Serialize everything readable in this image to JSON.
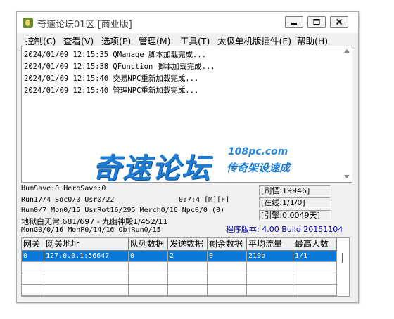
{
  "window": {
    "title": "奇速论坛01区 [商业版]"
  },
  "menu": [
    "控制(C)",
    "查看(V)",
    "选项(P)",
    "管理(M)",
    "工具(T)",
    "太极单机版插件(E)",
    "帮助(H)"
  ],
  "log": [
    "2024/01/09 12:15:35 QManage 脚本加载完成...",
    "2024/01/09 12:15:38 QFunction 脚本加载完成...",
    "2024/01/09 12:15:40 交易NPC重新加载完成...",
    "2024/01/09 12:15:40 管理NPC重新加载完成..."
  ],
  "watermark": {
    "main": "奇速论坛",
    "url": "108pc.com",
    "slogan": "传奇架设速成"
  },
  "status": {
    "line1": "HumSave:0 HeroSave:0",
    "line2a": "Run17/4 Soc0/0 Usr0/22",
    "line2b": "0:7:4 [M][F]",
    "line3": "Hum0/7 Mon0/15 UsrRot16/295 Merch0/16 Npc0/0 (0)",
    "line4": "地狱白无常,681/697 - 九幽神殿1/452/11",
    "line5": "MonG0/0/16 MonP0/14/16 ObjRun0/15"
  },
  "boxes": {
    "refresh": "[刷怪:19946]",
    "online": "[在线:1/1/0]",
    "engine": "[引擎:0.0049天]"
  },
  "version": "程序版本: 4.00 Build 20151104",
  "table": {
    "headers": [
      "网关",
      "网关地址",
      "队列数据",
      "发送数据",
      "剩余数据",
      "平均流量",
      "最高人数"
    ],
    "rows": [
      [
        "0",
        "127.0.0.1:56647",
        "0",
        "2",
        "0",
        "219b",
        "1/1"
      ]
    ]
  },
  "colors": {
    "selection": "#0a78d7",
    "version_text": "#0000a0",
    "watermark": "#1e7bd0"
  },
  "icons": [
    "app-icon",
    "minimize-icon",
    "maximize-icon",
    "close-icon"
  ]
}
